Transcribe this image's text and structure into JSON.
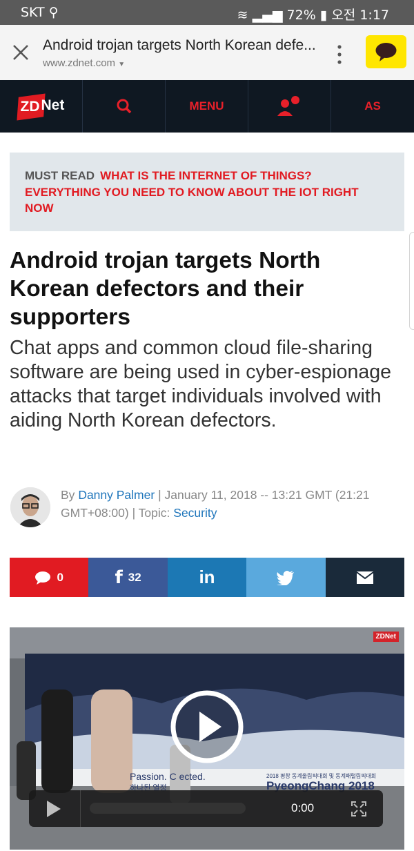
{
  "status_bar": {
    "carrier": "SKT",
    "battery": "72%",
    "time": "오전 1:17"
  },
  "browser": {
    "page_title": "Android trojan targets North Korean defe...",
    "host": "www.zdnet.com"
  },
  "nav": {
    "logo_zd": "ZD",
    "logo_net": "Net",
    "menu": "MENU",
    "edition": "AS"
  },
  "must_read": {
    "label": "MUST READ",
    "link": "WHAT IS THE INTERNET OF THINGS? EVERYTHING YOU NEED TO KNOW ABOUT THE IOT RIGHT NOW"
  },
  "article": {
    "headline": "Android trojan targets North Korean defectors and their supporters",
    "subhead": "Chat apps and common cloud file-sharing software are being used in cyber-espionage attacks that target individuals involved with aiding North Korean defectors."
  },
  "byline": {
    "by": "By",
    "author": "Danny Palmer",
    "date": "| January 11, 2018 -- 13:21 GMT (21:21 GMT+08:00) | Topic:",
    "topic": "Security"
  },
  "share": {
    "comments": "0",
    "facebook": "32",
    "linkedin": "in"
  },
  "video": {
    "time": "0:00",
    "logo": "ZDNet",
    "scene_text_1": "Passion. C    ected.",
    "scene_text_2": "2018 평창 동계올림픽대회 및 동계패럴림픽대회",
    "scene_text_3": "PyeongChang 2018",
    "scene_text_4": "하나된 열정"
  },
  "colors": {
    "brand_red": "#e11b22",
    "nav_bg": "#0f1822",
    "link_blue": "#1e75bb",
    "facebook": "#3b5998",
    "linkedin": "#1c78b4",
    "twitter": "#5aa9dd",
    "email": "#1a2a3a"
  }
}
